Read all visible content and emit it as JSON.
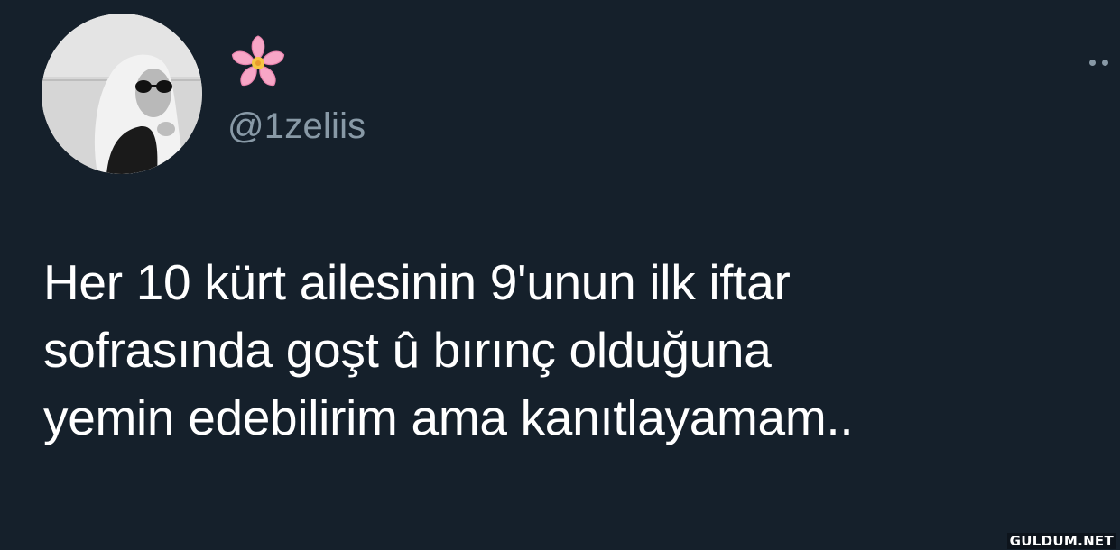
{
  "tweet": {
    "display_name": "🌸",
    "handle": "@1zeliis",
    "text_lines": [
      "Her 10 kürt ailesinin 9'unun ilk iftar",
      "sofrasında goşt û bırınç olduğuna",
      "yemin edebilirim ama kanıtlayamam.."
    ],
    "avatar_icon": "profile-photo-hijab-sunglasses",
    "more_icon": "more-dots-icon"
  },
  "watermark": "GULDUM.NET",
  "colors": {
    "background": "#15202b",
    "text": "#ffffff",
    "secondary_text": "#8899a6"
  }
}
